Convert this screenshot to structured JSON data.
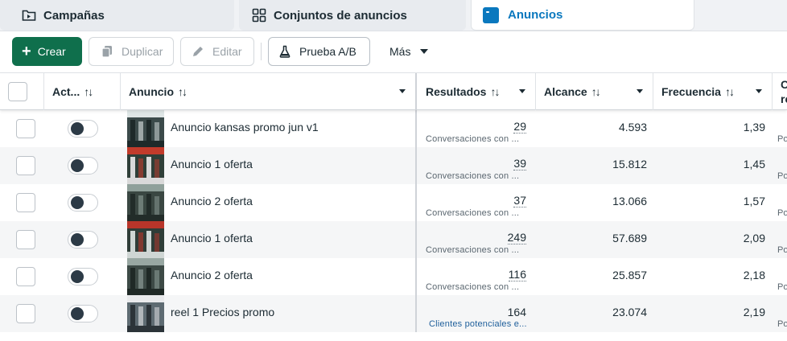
{
  "tabs": [
    {
      "label": "Campañas",
      "icon": "folder-icon"
    },
    {
      "label": "Conjuntos de anuncios",
      "icon": "grid-icon"
    },
    {
      "label": "Anuncios",
      "icon": "ad-icon",
      "active": true
    }
  ],
  "toolbar": {
    "create_label": "Crear",
    "duplicate_label": "Duplicar",
    "edit_label": "Editar",
    "ab_test_label": "Prueba A/B",
    "more_label": "Más"
  },
  "columns": {
    "active": "Act...",
    "ad": "Anuncio",
    "results": "Resultados",
    "reach": "Alcance",
    "frequency": "Frecuencia",
    "next": "C re",
    "sort_glyph": "↑↓"
  },
  "rows": [
    {
      "name": "Anuncio kansas promo jun v1",
      "results": "29",
      "results_type": "Conversaciones con ...",
      "reach": "4.593",
      "frequency": "1,39",
      "next": "Po"
    },
    {
      "name": "Anuncio 1 oferta",
      "results": "39",
      "results_type": "Conversaciones con ...",
      "reach": "15.812",
      "frequency": "1,45",
      "next": "Po"
    },
    {
      "name": "Anuncio 2 oferta",
      "results": "37",
      "results_type": "Conversaciones con ...",
      "reach": "13.066",
      "frequency": "1,57",
      "next": "Po"
    },
    {
      "name": "Anuncio 1 oferta",
      "results": "249",
      "results_type": "Conversaciones con ...",
      "reach": "57.689",
      "frequency": "2,09",
      "next": "Po"
    },
    {
      "name": "Anuncio 2 oferta",
      "results": "116",
      "results_type": "Conversaciones con ...",
      "reach": "25.857",
      "frequency": "2,18",
      "next": "Po"
    },
    {
      "name": "reel 1 Precios promo",
      "results": "164",
      "results_type": "Clientes potenciales e...",
      "reach": "23.074",
      "frequency": "2,19",
      "next": "Po"
    }
  ],
  "colors": {
    "accent_blue": "#0a78be",
    "create_green": "#0f6f4c"
  }
}
